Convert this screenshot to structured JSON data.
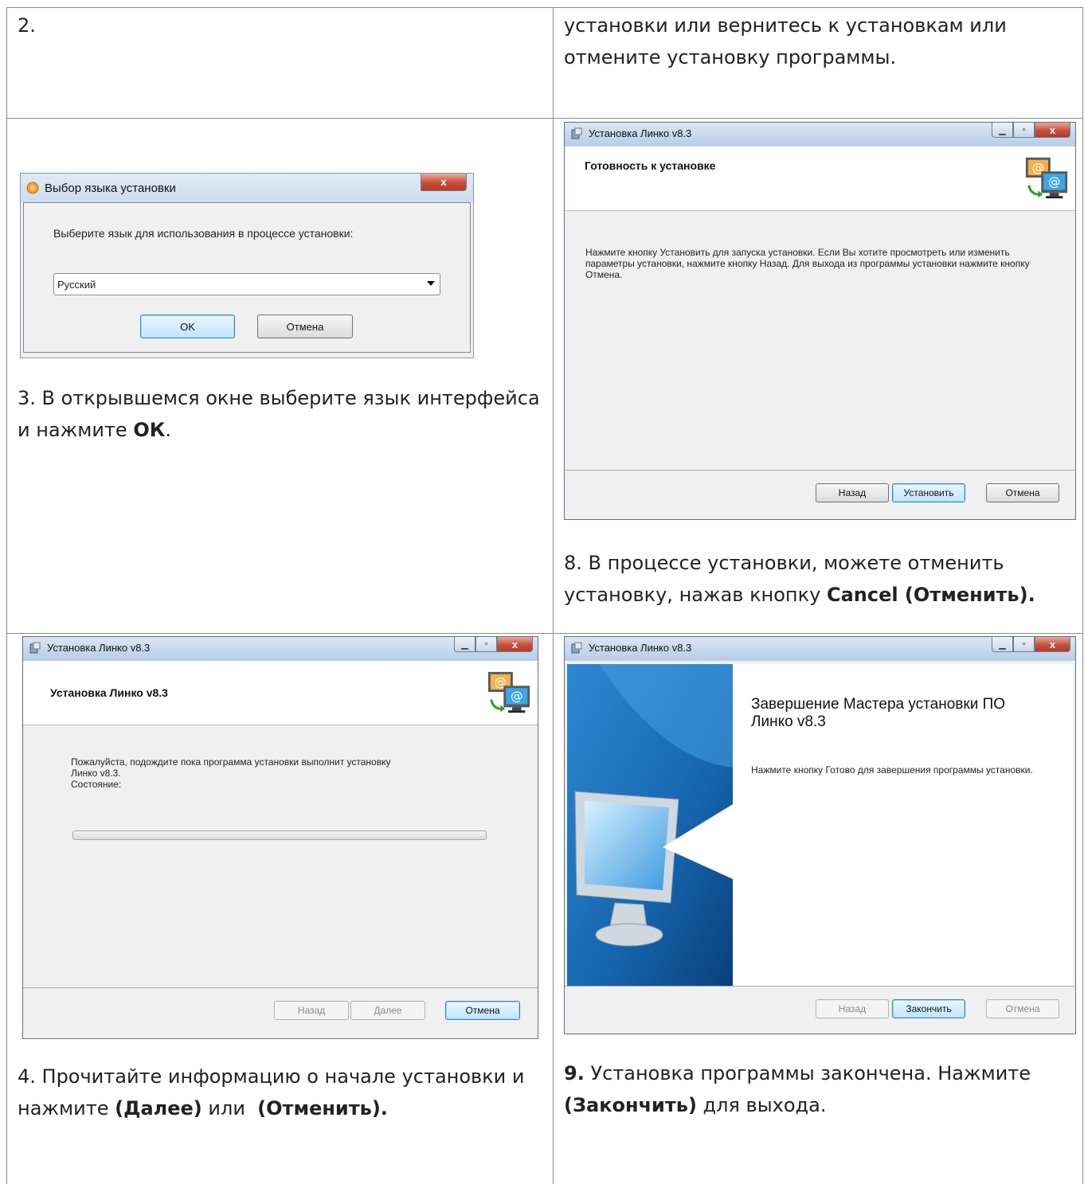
{
  "cells": {
    "top_left": "2.",
    "top_right": "установки или вернитесь к установкам или отмените установку программы.",
    "step3": {
      "prefix": "3. В открывшемся окне выберите язык интерфейса и нажмите ",
      "bold": "ОК",
      "suffix": "."
    },
    "step8": {
      "prefix": "8. В процессе установки, можете отменить установку, нажав кнопку ",
      "bold": "Cancel (Отменить)."
    },
    "step4": {
      "prefix": "4. Прочитайте информацию о начале установки и нажмите ",
      "bold1": "(Далее)",
      "middle": " или  ",
      "bold2": "(Отменить)."
    },
    "step9": {
      "bold1": "9.",
      "text1": " Установка программы закончена. Нажмите ",
      "bold2": "(Закончить)",
      "text2": " для выхода."
    }
  },
  "lang_dialog": {
    "title": "Выбор языка установки",
    "prompt": "Выберите язык для использования в процессе установки:",
    "selected_language": "Русский",
    "ok_label": "OK",
    "cancel_label": "Отмена",
    "close_glyph": "x"
  },
  "ready_dialog": {
    "title": "Установка Линко v8.3",
    "header": "Готовность к установке",
    "body": "Нажмите кнопку Установить для запуска установки. Если Вы хотите просмотреть или изменить параметры установки, нажмите кнопку Назад. Для выхода из программы установки нажмите кнопку Отмена.",
    "back_label": "Назад",
    "install_label": "Установить",
    "cancel_label": "Отмена"
  },
  "progress_dialog": {
    "title": "Установка Линко v8.3",
    "header": "Установка Линко v8.3",
    "body_line1": "Пожалуйста, подождите пока программа установки выполнит установку",
    "body_line2": "Линко v8.3.",
    "status_label": "Состояние:",
    "progress_fraction": 0,
    "back_label": "Назад",
    "next_label": "Далее",
    "cancel_label": "Отмена"
  },
  "finish_dialog": {
    "title": "Установка Линко v8.3",
    "heading_line1": "Завершение Мастера установки ПО",
    "heading_line2": "Линко v8.3",
    "body": "Нажмите кнопку Готово для завершения программы установки.",
    "back_label": "Назад",
    "finish_label": "Закончить",
    "cancel_label": "Отмена"
  },
  "colors": {
    "grid": "#8a8a8a",
    "wizard_banner_blue": "#1e6fb8",
    "default_button_border": "#3c7fb1"
  },
  "icons": [
    "installer-app-icon",
    "setup-globe-icon",
    "computers-email-icon",
    "monitor-arrow-illustration",
    "close-icon",
    "minimize-icon",
    "maximize-icon",
    "dropdown-arrow-icon"
  ]
}
